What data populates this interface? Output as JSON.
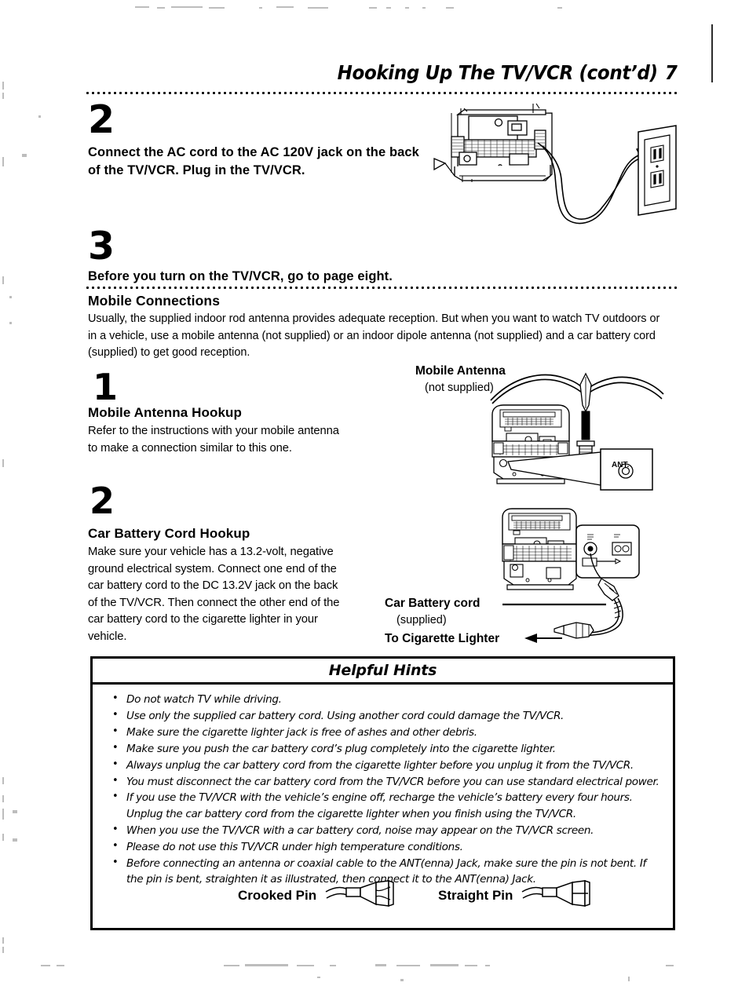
{
  "page": {
    "header_title": "Hooking Up The TV/VCR (cont’d)",
    "page_number": "7"
  },
  "steps": [
    {
      "number": "2",
      "text": "Connect the AC cord to the AC 120V jack on the back of the TV/VCR. Plug in the TV/VCR."
    },
    {
      "number": "3",
      "text": "Before you turn on the TV/VCR, go to page eight."
    }
  ],
  "mobile_connections": {
    "heading": "Mobile Connections",
    "intro": "Usually, the supplied indoor rod antenna provides adequate reception.  But when you want to watch TV outdoors or in a vehicle, use a mobile antenna (not supplied) or an indoor dipole antenna (not supplied) and a car battery cord (supplied) to get good reception.",
    "items": [
      {
        "number": "1",
        "heading": "Mobile Antenna Hookup",
        "text": "Refer to the instructions with your mobile antenna to make a connection similar to this one."
      },
      {
        "number": "2",
        "heading": "Car Battery Cord Hookup",
        "text": "Make sure your vehicle has a 13.2-volt, negative ground electrical system.  Connect one end of the car battery cord to the DC 13.2V jack on the back of the TV/VCR. Then connect the other end of the car battery cord to the cigarette lighter in your vehicle."
      }
    ]
  },
  "figures": {
    "mobile_antenna": {
      "label": "Mobile Antenna",
      "sublabel": "(not supplied)",
      "jack_label": "ANT."
    },
    "car_battery": {
      "label": "Car Battery cord",
      "sublabel": "(supplied)",
      "lighter_label": "To Cigarette Lighter"
    }
  },
  "helpful_hints": {
    "title": "Helpful Hints",
    "items": [
      "Do not watch TV while driving.",
      "Use only the supplied car battery cord.  Using another cord could damage the TV/VCR.",
      "Make sure the cigarette lighter jack is free of ashes and other debris.",
      "Make sure you push the car battery cord’s plug completely into the cigarette lighter.",
      "Always unplug the car battery cord from the cigarette lighter before you unplug it from the TV/VCR.",
      "You must disconnect the car battery cord from the TV/VCR before you can use standard electrical power.",
      "If you use the TV/VCR with the vehicle’s engine off, recharge the vehicle’s battery every four hours.  Unplug the car battery cord from the cigarette lighter when you finish using the TV/VCR.",
      "When you use the TV/VCR with a car battery cord, noise may appear on the TV/VCR screen.",
      "Please do not use this TV/VCR under high temperature conditions.",
      "Before connecting an antenna or coaxial cable to the ANT(enna) Jack, make sure the pin is not bent. If the pin is bent, straighten it as illustrated, then connect it to the ANT(enna) Jack."
    ],
    "pin_examples": [
      {
        "label": "Crooked Pin"
      },
      {
        "label": "Straight Pin"
      }
    ]
  },
  "colors": {
    "ink": "#000000",
    "paper": "#ffffff"
  }
}
